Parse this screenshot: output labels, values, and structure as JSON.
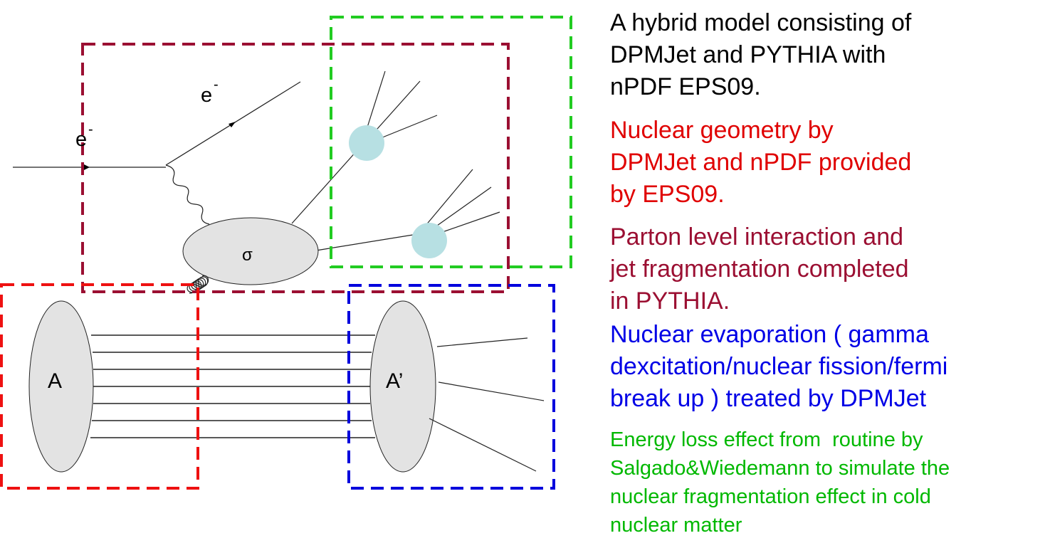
{
  "diagram": {
    "labels": {
      "electron_out": "e",
      "electron_in": "e",
      "electron_charge": "-",
      "sigma": "σ",
      "nucleus": "A",
      "nucleus_remnant": "A’"
    },
    "colors": {
      "pythia_box": "#9b0f32",
      "energy_loss_box": "#22cc22",
      "geometry_box": "#ee1111",
      "evaporation_box": "#0000dd",
      "ellipse_fill": "#e3e3e3",
      "jet_blob_fill": "#b7e0e3"
    }
  },
  "notes": {
    "hybrid_model": [
      "A hybrid model consisting of",
      "DPMJet and PYTHIA with",
      "nPDF EPS09."
    ],
    "nuclear_geometry": [
      "Nuclear geometry by",
      "DPMJet and nPDF provided",
      "by EPS09."
    ],
    "parton_level": [
      "Parton level interaction and",
      "jet fragmentation completed",
      "in PYTHIA."
    ],
    "evaporation": [
      "Nuclear evaporation ( gamma",
      "dexcitation/nuclear fission/fermi",
      "break up ) treated by DPMJet"
    ],
    "energy_loss": [
      "Energy loss effect from  routine by",
      "Salgado&Wiedemann to simulate the",
      "nuclear fragmentation effect in cold",
      "nuclear matter"
    ]
  }
}
